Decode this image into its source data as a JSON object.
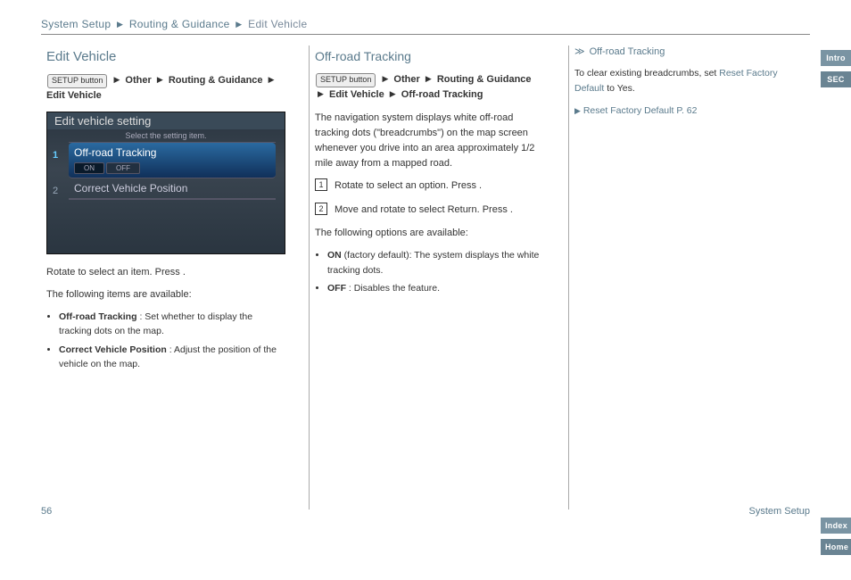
{
  "header": {
    "crumb1": "System Setup",
    "crumb2": "Routing & Guidance",
    "crumb3": "Edit Vehicle"
  },
  "sidetabs": {
    "top": [
      {
        "label": "Intro"
      },
      {
        "label": "SEC"
      }
    ],
    "bottom": [
      {
        "label": "Index"
      },
      {
        "label": "Home"
      }
    ]
  },
  "col1": {
    "title": "Edit Vehicle",
    "path_parts": [
      "SETUP button",
      "Other",
      "Routing & Guidance",
      "Edit Vehicle"
    ],
    "device": {
      "title": "Edit vehicle setting",
      "subtitle": "Select the setting item.",
      "rows": [
        {
          "num": "1",
          "label": "Off-road Tracking",
          "toggle": {
            "on": "ON",
            "off": "OFF"
          }
        },
        {
          "num": "2",
          "label": "Correct Vehicle Position"
        }
      ]
    },
    "body": {
      "intro": "Rotate to select an item. Press .",
      "selectword": "Rotate",
      "items_label": "The following items are available:",
      "items": [
        {
          "strong": "Off-road Tracking",
          "text": ": Set whether to display the tracking dots on the map."
        },
        {
          "strong": "Correct Vehicle Position",
          "text": ": Adjust the position of the vehicle on the map."
        }
      ]
    }
  },
  "col2": {
    "title": "Off-road Tracking",
    "path_parts": [
      "SETUP button",
      "Other",
      "Routing & Guidance",
      "Edit Vehicle",
      "Off-road Tracking"
    ],
    "body": {
      "para": "The navigation system displays white off-road tracking dots (\"breadcrumbs\") on the map screen whenever you drive into an area approximately 1/2 mile away from a mapped road."
    },
    "steps": [
      {
        "n": "1",
        "text": "Rotate to select an option. Press ."
      },
      {
        "n": "2",
        "text": "Move and rotate to select Return. Press ."
      }
    ],
    "options_label": "The following options are available:",
    "options": [
      {
        "strong": "ON",
        "text": " (factory default): The system displays the white tracking dots."
      },
      {
        "strong": "OFF",
        "text": ": Disables the feature."
      }
    ]
  },
  "col3": {
    "title": "Off-road Tracking",
    "text_before": "To clear existing breadcrumbs, set ",
    "link": "Reset Factory Default",
    "text_after": " to Yes.",
    "xref": "Reset Factory Default",
    "xref_page": "P. 62"
  },
  "footer": {
    "page": "56",
    "right": "System Setup"
  }
}
